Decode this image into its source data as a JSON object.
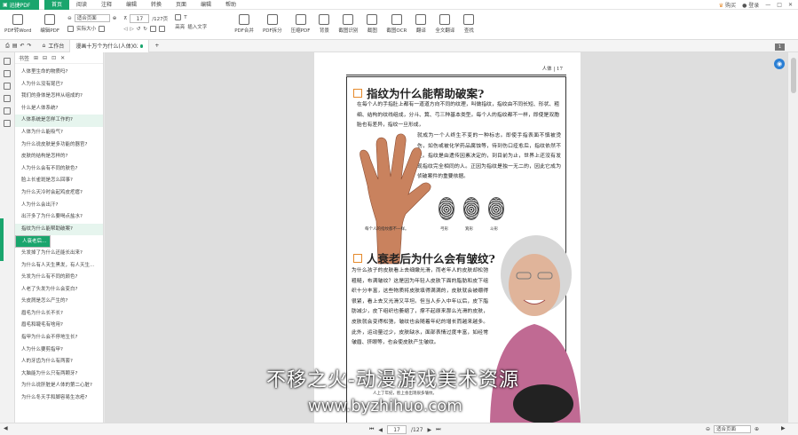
{
  "app": {
    "name": "迅捷PDF"
  },
  "menu": [
    "首页",
    "阅读",
    "注释",
    "编辑",
    "转换",
    "页面",
    "编辑",
    "帮助"
  ],
  "menu_active_index": 0,
  "title_right": {
    "buy": "购买",
    "login": "登录"
  },
  "toolbar": {
    "pdf_to_word": "PDF转Word",
    "edit_pdf": "编辑PDF",
    "zoom_select": "适合页面",
    "actual_size": "实际大小",
    "page_current": "17",
    "page_total": "/127页",
    "highlight": "高亮",
    "insert_text": "插入文字",
    "pdf_merge": "PDF合并",
    "pdf_split": "PDF拆分",
    "compress_pdf": "压缩PDF",
    "background": "背景",
    "screenshot_recognize": "截图识别",
    "snapshot": "截图",
    "screenshot_ocr": "截图OCR",
    "translate": "翻译",
    "full_translate": "全文翻译",
    "find": "查找"
  },
  "tabs": {
    "workbench": "工作台",
    "document": "漫画十万个为什么(人体)02..."
  },
  "bookmarks": {
    "title": "书签",
    "items": [
      "人体里生命的物质吗?",
      "人为什么没有尾巴?",
      "我们的身体是怎样从组成的?",
      "什么是人体系统?",
      "人体系统是怎样工作的?",
      "人体为什么能吸气?",
      "为什么说皮肤是多功能的器官?",
      "皮肤的结构是怎样的?",
      "人为什么会有不同的肤色?",
      "脸上长雀斑是怎么回事?",
      "为什么天冷时会起鸡皮疙瘩?",
      "人为什么会出汗?",
      "出汗多了为什么要喝点盐水?",
      "指纹为什么能帮助破案?",
      "人衰老后为什么会有皱纹?",
      "头发掉了为什么还能长出来?",
      "为什么有人天生黑发，有人天生...",
      "头发为什么有不同的颜色?",
      "人老了头发为什么会变白?",
      "头皮屑是怎么产生的?",
      "眉毛为什么长不长?",
      "眉毛和睫毛有啥用?",
      "指甲为什么会不停地生长?",
      "人为什么要剪指甲?",
      "人的牙齿为什么有两套?",
      "大脑能为什么只有两颗牙?",
      "为什么说肝脏是人体的第二心脏?",
      "为什么冬天手和脚容易生冻疮?"
    ],
    "highlighted_index": 13,
    "selected_index": 14,
    "light_index": 4
  },
  "page": {
    "running_head": "人体 | 17",
    "heading1": "指纹为什么能帮助破案?",
    "para1": "在每个人的手指肚上都有一道道方向不同的纹理，叫做指纹，指纹由不同长短、形状、粗细、结构的纹线组成，分斗、箕、弓三种基本类型。每个人的指纹都不一样，即使是双胞胎也有差异，指纹一旦形成，",
    "para2": "就成为一个人终生不变的一种标志。即使手指表面不慎被烫伤，如伤或被化学药品腐蚀等，待到伤口痊愈后，指纹依然不变。指纹是由遗传因素决定的，到目前为止，世界上还没有发现指纹完全相同的人。正因为指纹是独一无二的，因此它成为侦破案件的重要依据。",
    "caption_hand": "每个人的指纹都不一样。",
    "fp_labels": [
      "弓形",
      "箕形",
      "斗形"
    ],
    "heading2": "人衰老后为什么会有皱纹?",
    "para3": "为什么孩子的皮肤看上去细嫩光滑，而老年人的皮肤却松弛粗糙，布满皱纹？这是因为年轻人皮肤下面的脂肪和皮下组织十分丰富，这些物质将皮肤填得满满的，皮肤就会被绷得很紧，看上去又光滑又平坦。但当人步入中年以后，皮下脂肪减少，皮下组织也萎缩了，撑不起原来那么光滑的皮肤，皮肤就会变得松弛，皱纹也会随着年纪的增长而越来越多。此外，运动量过少，皮肤缺水，面部表情过度丰富，如经常皱眉、挤眼等，也会使皮肤产生皱纹。",
    "caption_woman": "人上了年纪，脸上会出现很多皱纹。"
  },
  "status": {
    "page_current": "17",
    "page_total": "/127",
    "zoom": "适合页面"
  },
  "watermark": {
    "line1": "不移之火-动漫游戏美术资源",
    "line2": "www.byzhihuo.com"
  },
  "colors": {
    "brand": "#1aa56d",
    "accent": "#e58a2c"
  }
}
